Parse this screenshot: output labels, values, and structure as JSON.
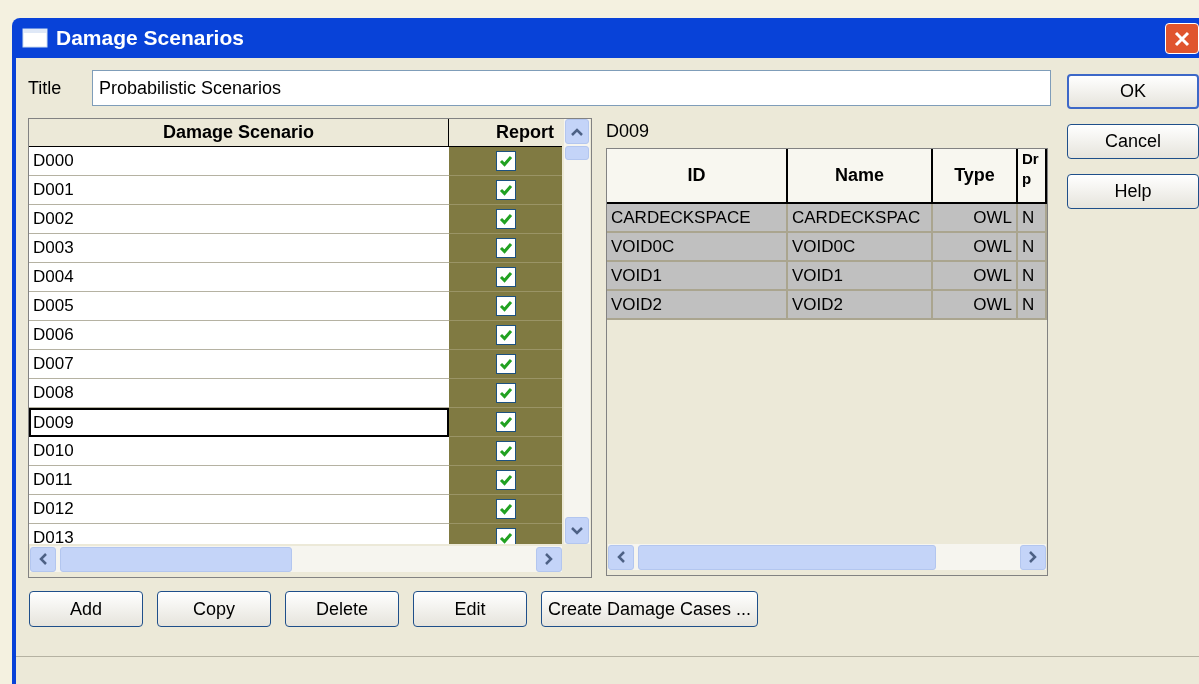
{
  "window": {
    "title": "Damage Scenarios"
  },
  "title_field": {
    "label": "Title",
    "value": "Probabilistic Scenarios"
  },
  "scenario_table": {
    "columns": [
      "Damage Scenario",
      "Report"
    ],
    "rows": [
      {
        "name": "D000",
        "report": true,
        "selected": false
      },
      {
        "name": "D001",
        "report": true,
        "selected": false
      },
      {
        "name": "D002",
        "report": true,
        "selected": false
      },
      {
        "name": "D003",
        "report": true,
        "selected": false
      },
      {
        "name": "D004",
        "report": true,
        "selected": false
      },
      {
        "name": "D005",
        "report": true,
        "selected": false
      },
      {
        "name": "D006",
        "report": true,
        "selected": false
      },
      {
        "name": "D007",
        "report": true,
        "selected": false
      },
      {
        "name": "D008",
        "report": true,
        "selected": false
      },
      {
        "name": "D009",
        "report": true,
        "selected": true
      },
      {
        "name": "D010",
        "report": true,
        "selected": false
      },
      {
        "name": "D011",
        "report": true,
        "selected": false
      },
      {
        "name": "D012",
        "report": true,
        "selected": false
      },
      {
        "name": "D013",
        "report": true,
        "selected": false
      }
    ]
  },
  "detail": {
    "heading": "D009",
    "columns": [
      "ID",
      "Name",
      "Type",
      "Dr p"
    ],
    "rows": [
      {
        "cells": [
          "CARDECKSPACE",
          "CARDECKSPAC",
          "OWL",
          "N"
        ]
      },
      {
        "cells": [
          "VOID0C",
          "VOID0C",
          "OWL",
          "N"
        ]
      },
      {
        "cells": [
          "VOID1",
          "VOID1",
          "OWL",
          "N"
        ]
      },
      {
        "cells": [
          "VOID2",
          "VOID2",
          "OWL",
          "N"
        ]
      }
    ]
  },
  "buttons": [
    "Add",
    "Copy",
    "Delete",
    "Edit",
    "Create Damage Cases ..."
  ],
  "dialog_buttons": [
    {
      "label": "OK",
      "default": true
    },
    {
      "label": "Cancel",
      "default": false
    },
    {
      "label": "Help",
      "default": false
    }
  ]
}
